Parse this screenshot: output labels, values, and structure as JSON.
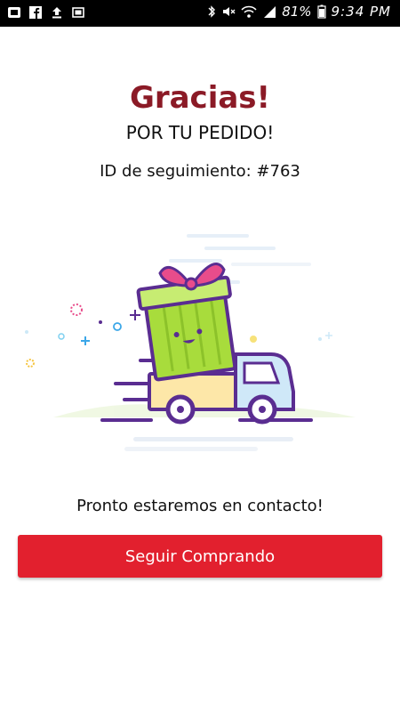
{
  "status_bar": {
    "battery": "81%",
    "time": "9:34 PM",
    "left_icons": [
      "ad-icon",
      "facebook-icon",
      "upload-icon",
      "image-icon"
    ],
    "right_icons": [
      "bluetooth-icon",
      "mute-icon",
      "wifi-icon",
      "signal-icon"
    ]
  },
  "confirmation": {
    "title": "Gracias!",
    "subtitle": "POR TU PEDIDO!",
    "tracking_label": "ID de seguimiento: ",
    "tracking_id": "#763",
    "contact_message": "Pronto estaremos en contacto!"
  },
  "actions": {
    "continue_label": "Seguir Comprando"
  },
  "colors": {
    "title": "#8b1a26",
    "button": "#e2202e",
    "truck_outline": "#5a2d91",
    "gift_green": "#a8dc3c",
    "ribbon_pink": "#e84c8b"
  }
}
